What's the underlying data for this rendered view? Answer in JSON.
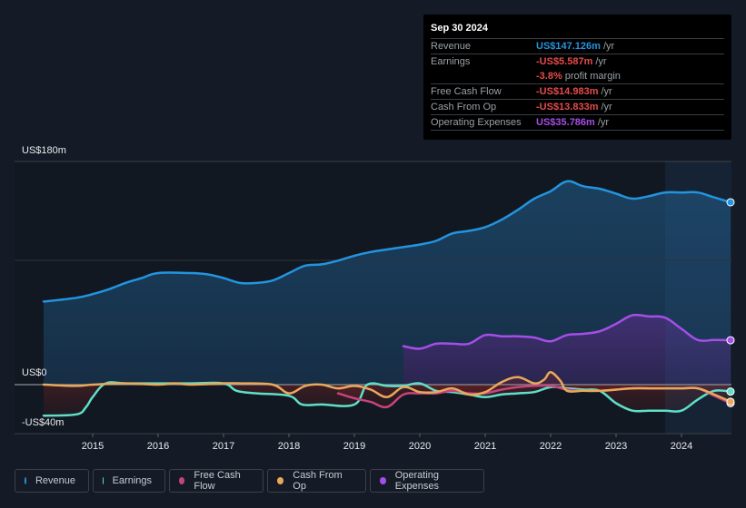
{
  "tooltip": {
    "date": "Sep 30 2024",
    "rows": [
      {
        "label": "Revenue",
        "value": "US$147.126m",
        "unit": "/yr",
        "color": "#2394df"
      },
      {
        "label": "Earnings",
        "value": "-US$5.587m",
        "unit": "/yr",
        "color": "#e64b4b"
      },
      {
        "label": "",
        "value": "-3.8%",
        "unit": "profit margin",
        "color": "#e64b4b"
      },
      {
        "label": "Free Cash Flow",
        "value": "-US$14.983m",
        "unit": "/yr",
        "color": "#e64b4b"
      },
      {
        "label": "Cash From Op",
        "value": "-US$13.833m",
        "unit": "/yr",
        "color": "#e64b4b"
      },
      {
        "label": "Operating Expenses",
        "value": "US$35.786m",
        "unit": "/yr",
        "color": "#a54ee8"
      }
    ]
  },
  "axis": {
    "y_top_label": "US$180m",
    "y_zero_label": "US$0",
    "y_bottom_label": "-US$40m"
  },
  "legend": [
    {
      "label": "Revenue",
      "color": "#2394df"
    },
    {
      "label": "Earnings",
      "color": "#5ee0c8"
    },
    {
      "label": "Free Cash Flow",
      "color": "#c7437e"
    },
    {
      "label": "Cash From Op",
      "color": "#e8a95a"
    },
    {
      "label": "Operating Expenses",
      "color": "#a54ee8"
    }
  ],
  "chart_data": {
    "type": "area",
    "title": "",
    "xlabel": "",
    "ylabel": "",
    "ylim": [
      -40,
      180
    ],
    "xlim": [
      2014.25,
      2024.75
    ],
    "xticks": [
      "2015",
      "2016",
      "2017",
      "2018",
      "2019",
      "2020",
      "2021",
      "2022",
      "2023",
      "2024"
    ],
    "forecast_shade_start": 2023.75,
    "grid": true,
    "series": [
      {
        "name": "Revenue",
        "color": "#2394df",
        "x": [
          2014.25,
          2014.75,
          2015.0,
          2015.25,
          2015.5,
          2015.75,
          2016.0,
          2016.5,
          2016.75,
          2017.0,
          2017.25,
          2017.5,
          2017.75,
          2018.0,
          2018.25,
          2018.5,
          2018.75,
          2019.0,
          2019.25,
          2019.5,
          2019.75,
          2020.0,
          2020.25,
          2020.5,
          2020.75,
          2021.0,
          2021.25,
          2021.5,
          2021.75,
          2022.0,
          2022.25,
          2022.5,
          2022.75,
          2023.0,
          2023.25,
          2023.5,
          2023.75,
          2024.0,
          2024.25,
          2024.5,
          2024.75
        ],
        "values": [
          67,
          70,
          73,
          77,
          82,
          86,
          90,
          90,
          89,
          86,
          82,
          82,
          84,
          90,
          96,
          97,
          100,
          104,
          107,
          109,
          111,
          113,
          116,
          122,
          124,
          127,
          133,
          141,
          150,
          156,
          164,
          160,
          158,
          154,
          150,
          152,
          155,
          155,
          155,
          151,
          147.1
        ]
      },
      {
        "name": "Earnings",
        "color": "#5ee0c8",
        "x": [
          2014.25,
          2014.75,
          2014.9,
          2015.0,
          2015.2,
          2015.5,
          2016.0,
          2016.5,
          2017.0,
          2017.2,
          2017.5,
          2018.0,
          2018.2,
          2018.5,
          2019.0,
          2019.2,
          2019.5,
          2019.75,
          2020.0,
          2020.25,
          2020.5,
          2020.75,
          2021.0,
          2021.25,
          2021.5,
          2021.75,
          2022.0,
          2022.25,
          2022.5,
          2022.75,
          2023.0,
          2023.25,
          2023.5,
          2023.75,
          2024.0,
          2024.25,
          2024.5,
          2024.75
        ],
        "values": [
          -25,
          -24,
          -18,
          -10,
          1,
          1,
          1,
          1,
          1,
          -5,
          -7,
          -9,
          -16,
          -16,
          -16,
          0,
          -1,
          -1,
          1,
          -5,
          -6,
          -8,
          -10,
          -8,
          -7,
          -6,
          -2,
          -3,
          -4,
          -5,
          -15,
          -21,
          -21,
          -21,
          -21,
          -12,
          -5,
          -5.6
        ]
      },
      {
        "name": "Free Cash Flow",
        "color": "#c7437e",
        "x": [
          2018.75,
          2019.0,
          2019.25,
          2019.5,
          2019.75,
          2020.0,
          2020.25,
          2020.5,
          2020.75,
          2021.0,
          2021.25,
          2021.5,
          2021.75,
          2022.0,
          2022.25,
          2022.5,
          2022.75,
          2023.0,
          2023.25,
          2023.5,
          2023.75,
          2024.0,
          2024.25,
          2024.5,
          2024.75
        ],
        "values": [
          -7,
          -11,
          -14,
          -18,
          -8,
          -7,
          -7,
          -5,
          -7,
          -7,
          -4,
          -2,
          -1,
          -1,
          -4,
          -5,
          -5,
          -4,
          -3,
          -3,
          -3,
          -3,
          -3,
          -9,
          -15.0
        ]
      },
      {
        "name": "Cash From Op",
        "color": "#e8a95a",
        "x": [
          2014.25,
          2014.75,
          2015.0,
          2015.5,
          2016.0,
          2016.25,
          2016.5,
          2017.0,
          2017.25,
          2017.75,
          2018.0,
          2018.25,
          2018.5,
          2018.75,
          2019.0,
          2019.25,
          2019.5,
          2019.75,
          2020.0,
          2020.25,
          2020.5,
          2020.75,
          2021.0,
          2021.25,
          2021.5,
          2021.75,
          2021.9,
          2022.0,
          2022.15,
          2022.25,
          2022.5,
          2022.75,
          2023.0,
          2023.25,
          2023.5,
          2023.75,
          2024.0,
          2024.25,
          2024.5,
          2024.75
        ],
        "values": [
          0,
          -1,
          0,
          1,
          0,
          1,
          0,
          1,
          1,
          0,
          -7,
          -1,
          0,
          -3,
          -1,
          -4,
          -10,
          -2,
          -6,
          -6,
          -3,
          -8,
          -6,
          2,
          6,
          1,
          4,
          10,
          3,
          -5,
          -5,
          -5,
          -4,
          -3,
          -3,
          -3,
          -3,
          -3,
          -8,
          -13.8
        ]
      },
      {
        "name": "Operating Expenses",
        "color": "#a54ee8",
        "x": [
          2019.75,
          2020.0,
          2020.25,
          2020.5,
          2020.75,
          2021.0,
          2021.25,
          2021.5,
          2021.75,
          2022.0,
          2022.25,
          2022.5,
          2022.75,
          2023.0,
          2023.25,
          2023.5,
          2023.75,
          2024.0,
          2024.25,
          2024.5,
          2024.75
        ],
        "values": [
          31,
          29,
          33,
          33,
          33,
          40,
          39,
          39,
          38,
          35,
          40,
          41,
          43,
          49,
          56,
          55,
          54,
          45,
          36,
          36,
          35.8
        ]
      }
    ]
  }
}
